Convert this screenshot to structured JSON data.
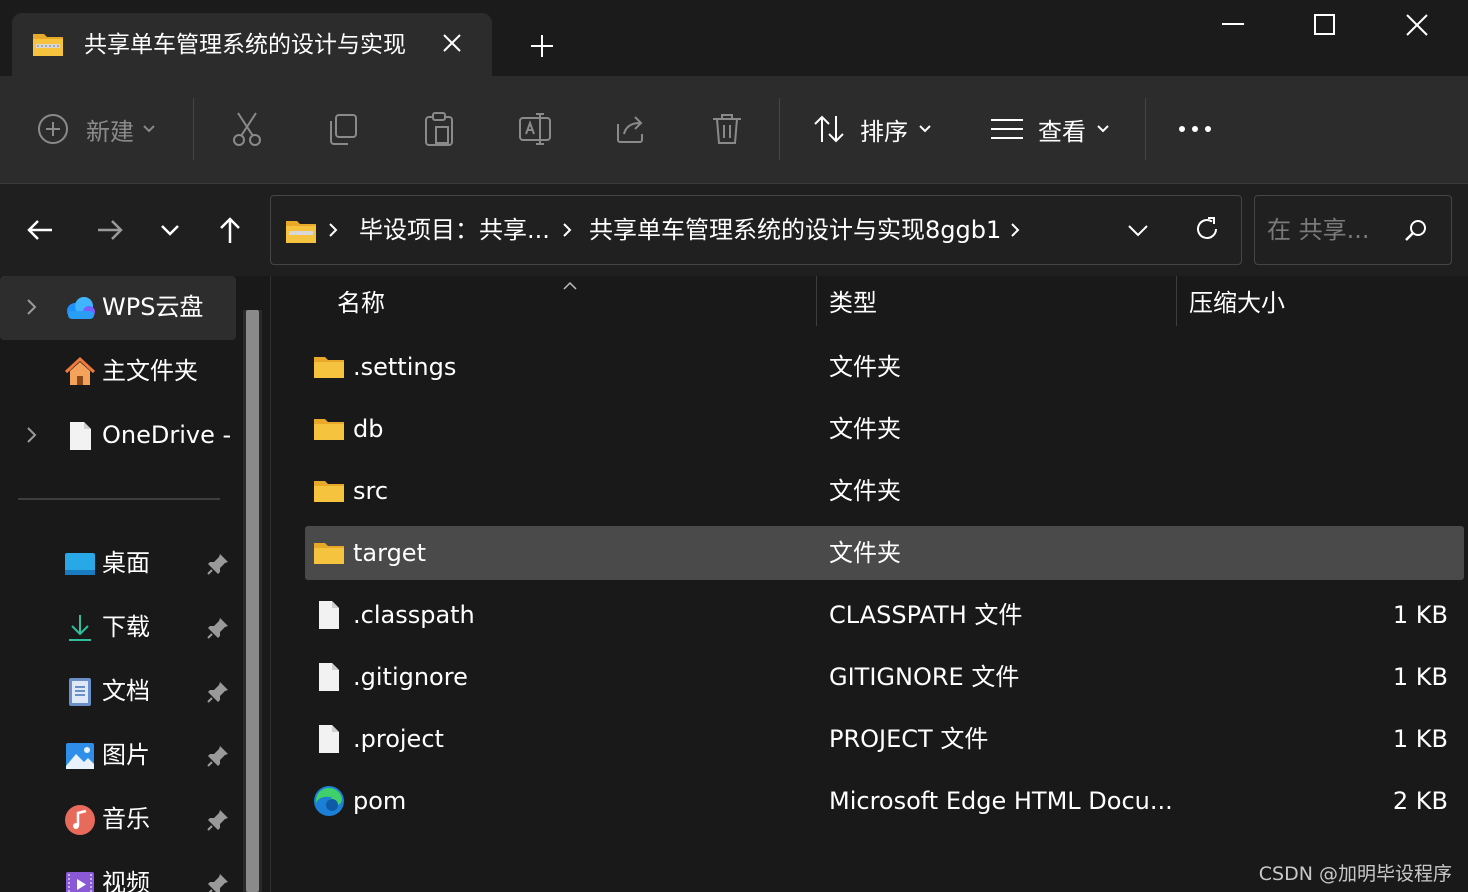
{
  "window": {
    "tab_title": "共享单车管理系统的设计与实现",
    "tab_icon": "folder-zip-icon"
  },
  "toolbar": {
    "new_label": "新建",
    "sort_label": "排序",
    "view_label": "查看",
    "more_label": "..."
  },
  "address": {
    "crumbs": [
      "毕设项目：共享...",
      "共享单车管理系统的设计与实现8ggb1"
    ],
    "search_placeholder": "在 共享..."
  },
  "sidebar": {
    "items": [
      {
        "label": "WPS云盘",
        "icon": "wps-cloud-icon",
        "expandable": true,
        "selected": true
      },
      {
        "label": "主文件夹",
        "icon": "home-icon",
        "expandable": false
      },
      {
        "label": "OneDrive -",
        "icon": "onedrive-file-icon",
        "expandable": true
      }
    ],
    "quick_access": [
      {
        "label": "桌面",
        "icon": "desktop-icon",
        "pinned": true
      },
      {
        "label": "下载",
        "icon": "download-icon",
        "pinned": true
      },
      {
        "label": "文档",
        "icon": "documents-icon",
        "pinned": true
      },
      {
        "label": "图片",
        "icon": "pictures-icon",
        "pinned": true
      },
      {
        "label": "音乐",
        "icon": "music-icon",
        "pinned": true
      },
      {
        "label": "视频",
        "icon": "videos-icon",
        "pinned": true
      }
    ]
  },
  "list": {
    "columns": {
      "name": "名称",
      "type": "类型",
      "size": "压缩大小"
    },
    "files": [
      {
        "name": ".settings",
        "type": "文件夹",
        "size": "",
        "icon": "folder-icon"
      },
      {
        "name": "db",
        "type": "文件夹",
        "size": "",
        "icon": "folder-icon"
      },
      {
        "name": "src",
        "type": "文件夹",
        "size": "",
        "icon": "folder-icon"
      },
      {
        "name": "target",
        "type": "文件夹",
        "size": "",
        "icon": "folder-icon",
        "selected": true
      },
      {
        "name": ".classpath",
        "type": "CLASSPATH 文件",
        "size": "1 KB",
        "icon": "file-icon"
      },
      {
        "name": ".gitignore",
        "type": "GITIGNORE 文件",
        "size": "1 KB",
        "icon": "file-icon"
      },
      {
        "name": ".project",
        "type": "PROJECT 文件",
        "size": "1 KB",
        "icon": "file-icon"
      },
      {
        "name": "pom",
        "type": "Microsoft Edge HTML Docu...",
        "size": "2 KB",
        "icon": "edge-icon"
      }
    ]
  },
  "watermark": "CSDN @加明毕设程序",
  "colors": {
    "folder": "#f6c33e",
    "background": "#191919",
    "toolbar": "#2c2c2c",
    "selection": "#4a4a4a"
  }
}
